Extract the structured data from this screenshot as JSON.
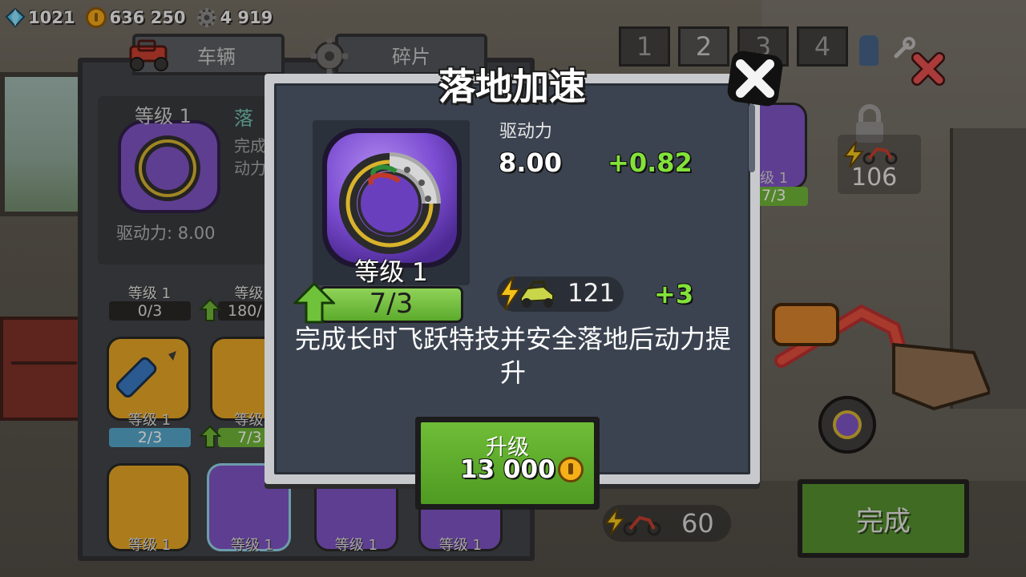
{
  "currencies": {
    "gems": "1021",
    "coins": "636 250",
    "parts": "4 919"
  },
  "tabs": {
    "vehicle": "车辆",
    "fragments": "碎片"
  },
  "level_tabs": [
    "1",
    "2",
    "3",
    "4"
  ],
  "back_panel": {
    "selected_level": "等级 1",
    "selected_name": "落",
    "selected_desc_1": "完成",
    "selected_desc_2": "动力",
    "drive_stat": "驱动力: 8.00",
    "row1": [
      {
        "level": "等级 1",
        "progress": "0/3"
      },
      {
        "level": "等级",
        "progress": "180/"
      }
    ],
    "row2": [
      {
        "level": "等级 1",
        "progress": "2/3"
      },
      {
        "level": "等级",
        "progress": "7/3"
      }
    ],
    "row3": [
      {
        "level": "等级 1"
      },
      {
        "level": "等级 1"
      },
      {
        "level": "等级 1"
      },
      {
        "level": "等级 1"
      }
    ]
  },
  "right_side": {
    "card_level": "级 1",
    "card_progress": "7/3",
    "side_count": "106",
    "bottom_count": "60",
    "done_label": "完成"
  },
  "modal": {
    "title": "落地加速",
    "part_level": "等级 1",
    "progress_text": "7/3",
    "progress_fraction": 1.0,
    "stat_label": "驱动力",
    "stat_value": "8.00",
    "stat_bonus": "+0.82",
    "vehicle_points": "121",
    "vehicle_bonus": "+3",
    "description": "完成长时飞跃特技并安全落地后动力提升",
    "upgrade_label": "升级",
    "upgrade_price": "13 000"
  },
  "colors": {
    "accent_green": "#83e23a",
    "button_green": "#5caa2c",
    "panel": "#3c4350",
    "close_red": "#e24b4b"
  },
  "icons": {
    "gem": "gem-icon",
    "coin": "coin-icon",
    "gear": "gear-icon",
    "close": "close-icon",
    "up_arrow": "up-arrow-icon",
    "bolt": "lightning-bolt-icon",
    "buggy": "buggy-icon"
  }
}
